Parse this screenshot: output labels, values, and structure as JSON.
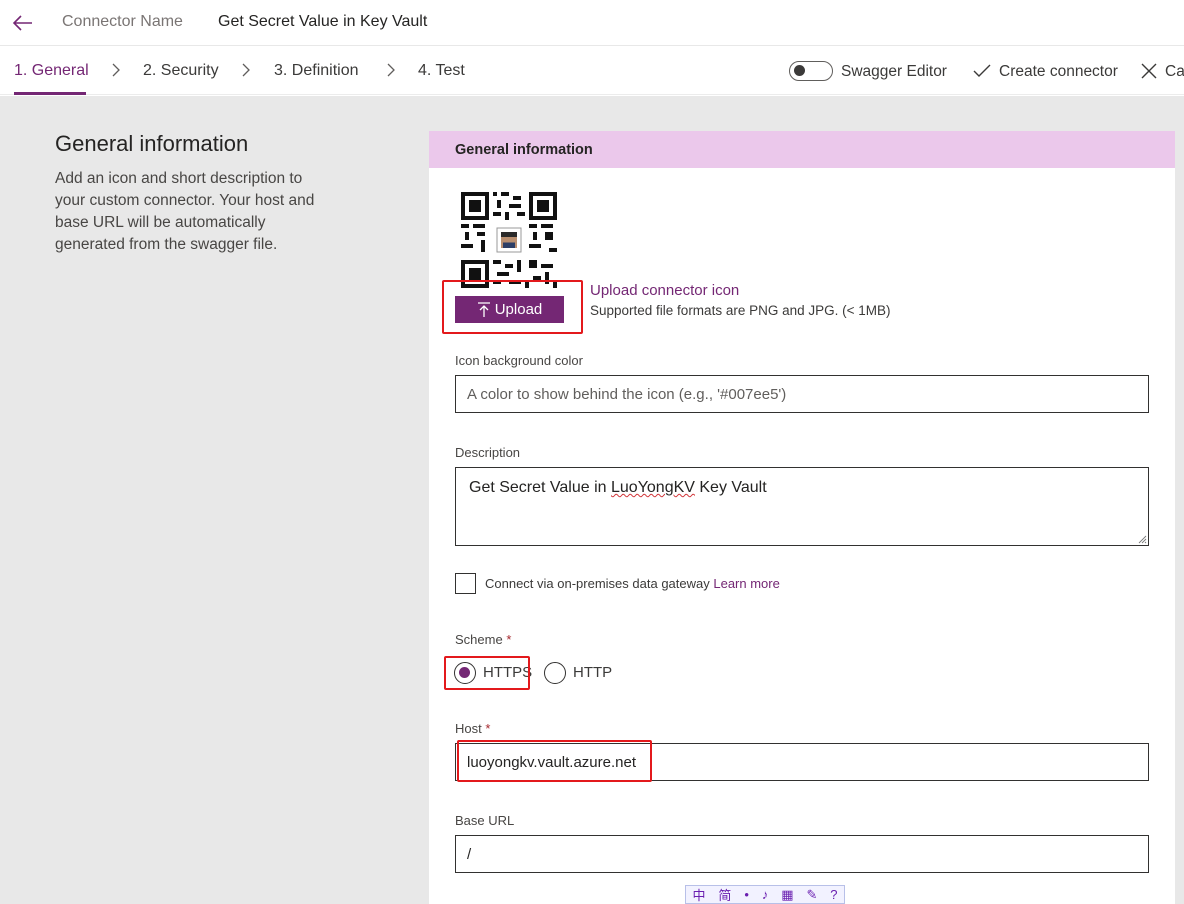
{
  "header": {
    "connector_name_label": "Connector Name",
    "connector_name_value": "Get Secret Value in Key Vault"
  },
  "steps": [
    {
      "label": "1. General",
      "active": true
    },
    {
      "label": "2. Security",
      "active": false
    },
    {
      "label": "3. Definition",
      "active": false
    },
    {
      "label": "4. Test",
      "active": false
    }
  ],
  "toolbar": {
    "swagger_editor_label": "Swagger Editor",
    "swagger_editor_on": false,
    "create_connector_label": "Create connector",
    "cancel_label": "Ca"
  },
  "sidebar": {
    "title": "General information",
    "description": "Add an icon and short description to your custom connector. Your host and base URL will be automatically generated from the swagger file."
  },
  "panel": {
    "header": "General information",
    "upload_button": "Upload",
    "upload_link": "Upload connector icon",
    "upload_hint": "Supported file formats are PNG and JPG. (< 1MB)",
    "icon_bg_label": "Icon background color",
    "icon_bg_placeholder": "A color to show behind the icon (e.g., '#007ee5')",
    "description_label": "Description",
    "description_prefix": "Get Secret Value in ",
    "description_misspelled": "LuoYongKV",
    "description_suffix": " Key Vault",
    "gateway_label": "Connect via on-premises data gateway",
    "gateway_link": "Learn more",
    "gateway_checked": false,
    "scheme_label": "Scheme",
    "required_mark": "*",
    "scheme_options": [
      {
        "label": "HTTPS",
        "selected": true
      },
      {
        "label": "HTTP",
        "selected": false
      }
    ],
    "host_label": "Host",
    "host_value": "luoyongkv.vault.azure.net",
    "base_url_label": "Base URL",
    "base_url_value": "/"
  },
  "ime_bar": {
    "items": [
      "中",
      "简",
      "•",
      "♪",
      "▦",
      "✎",
      "?"
    ]
  },
  "colors": {
    "accent": "#742774",
    "panel_header_bg": "#ebc8eb",
    "highlight_box": "#e3191c",
    "page_bg": "#e8e8e8"
  },
  "icons": [
    "back-arrow-icon",
    "chevron-right-icon",
    "checkmark-icon",
    "close-icon",
    "upload-arrow-icon",
    "qr-code-icon"
  ]
}
